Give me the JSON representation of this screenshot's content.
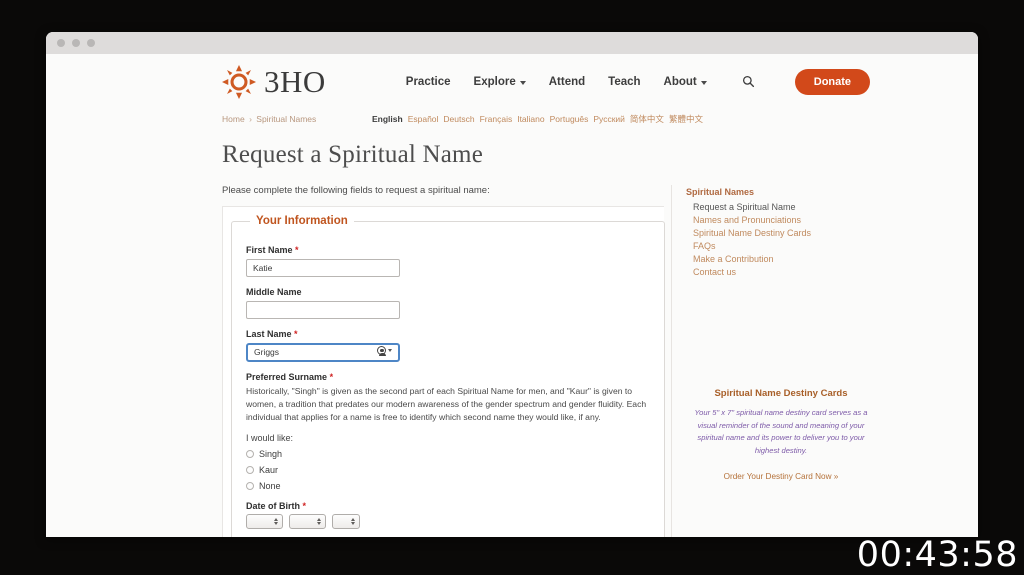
{
  "browser": {
    "dots": 3
  },
  "site": {
    "brand": "3HO",
    "logo_icon": "sun-icon",
    "nav": [
      {
        "label": "Practice",
        "has_caret": false
      },
      {
        "label": "Explore",
        "has_caret": true
      },
      {
        "label": "Attend",
        "has_caret": false
      },
      {
        "label": "Teach",
        "has_caret": false
      },
      {
        "label": "About",
        "has_caret": true
      }
    ],
    "search_icon": "search-icon",
    "donate_label": "Donate"
  },
  "breadcrumb": {
    "home": "Home",
    "separator": "›",
    "current": "Spiritual Names"
  },
  "languages": [
    {
      "label": "English",
      "active": true
    },
    {
      "label": "Español",
      "active": false
    },
    {
      "label": "Deutsch",
      "active": false
    },
    {
      "label": "Français",
      "active": false
    },
    {
      "label": "Italiano",
      "active": false
    },
    {
      "label": "Português",
      "active": false
    },
    {
      "label": "Русский",
      "active": false
    },
    {
      "label": "简体中文",
      "active": false
    },
    {
      "label": "繁體中文",
      "active": false
    }
  ],
  "page": {
    "title": "Request a Spiritual Name",
    "intro": "Please complete the following fields to request a spiritual name:"
  },
  "form": {
    "legend": "Your Information",
    "required_mark": "*",
    "first_name": {
      "label": "First Name",
      "value": "Katie",
      "required": true
    },
    "middle_name": {
      "label": "Middle Name",
      "value": "",
      "required": false
    },
    "last_name": {
      "label": "Last Name",
      "value": "Griggs",
      "required": true,
      "focused": true,
      "autofill_icon": "person-autofill-icon"
    },
    "preferred_surname": {
      "label": "Preferred Surname",
      "required": true,
      "help": "Historically, \"Singh\" is given as the second part of each Spiritual Name for men, and \"Kaur\" is given to women, a tradition that predates our modern awareness of the gender spectrum and gender fluidity. Each individual that applies for a name is free to identify which second name they would like, if any.",
      "prompt": "I would like:",
      "options": [
        {
          "label": "Singh",
          "selected": false
        },
        {
          "label": "Kaur",
          "selected": false
        },
        {
          "label": "None",
          "selected": false
        }
      ]
    },
    "date_of_birth": {
      "label": "Date of Birth",
      "required": true,
      "selects": [
        {
          "name": "year",
          "value": ""
        },
        {
          "name": "month",
          "value": ""
        },
        {
          "name": "day",
          "value": ""
        }
      ]
    }
  },
  "sidebar": {
    "heading": "Spiritual Names",
    "links": [
      {
        "label": "Request a Spiritual Name",
        "current": true
      },
      {
        "label": "Names and Pronunciations",
        "current": false
      },
      {
        "label": "Spiritual Name Destiny Cards",
        "current": false
      },
      {
        "label": "FAQs",
        "current": false
      },
      {
        "label": "Make a Contribution",
        "current": false
      },
      {
        "label": "Contact us",
        "current": false
      }
    ],
    "promo": {
      "title": "Spiritual Name Destiny Cards",
      "body": "Your 5\" x 7\" spiritual name destiny card serves as a visual reminder of the sound and meaning of your spiritual name and its power to deliver you to your highest destiny.",
      "cta": "Order Your Destiny Card Now »"
    }
  },
  "overlay": {
    "timer": "00:43:58"
  },
  "colors": {
    "accent_orange": "#d2491a",
    "link_tan": "#c08a5e",
    "legend_orange": "#c0551f",
    "required_red": "#cf2222",
    "promo_purple": "#7d5aa8",
    "focus_blue": "#4e86c6"
  }
}
